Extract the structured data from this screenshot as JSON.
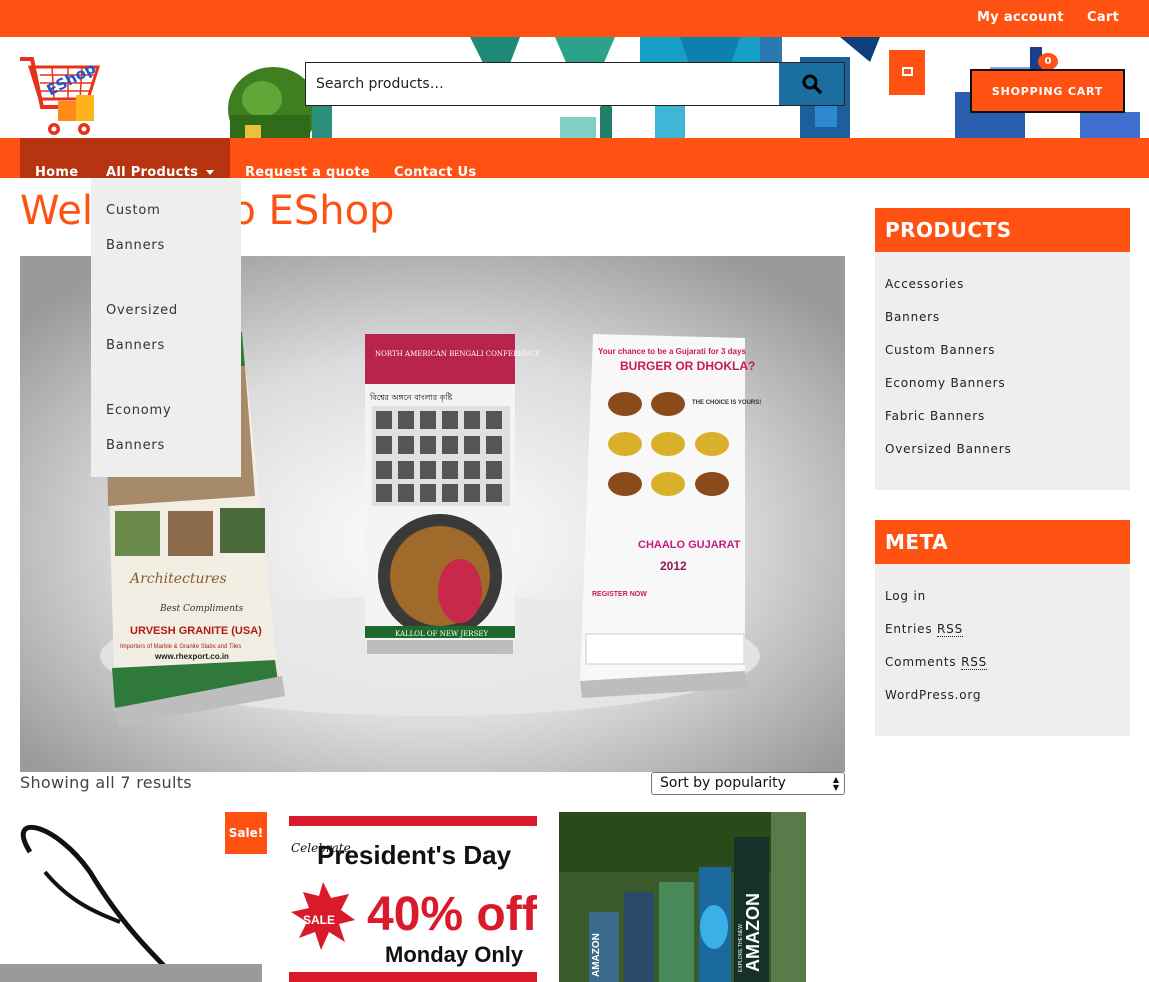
{
  "topbar": {
    "my_account": "My account",
    "cart": "Cart"
  },
  "header": {
    "logo_text": "EShop",
    "search_placeholder": "Search products…",
    "cart_count": "0",
    "shopping_cart_label": "SHOPPING CART"
  },
  "nav": {
    "items": [
      "Home",
      "All Products",
      "Request a quote",
      "Contact Us"
    ],
    "dropdown": [
      "Custom",
      "Banners",
      "Oversized",
      "Banners",
      "Economy",
      "Banners"
    ]
  },
  "page": {
    "title": "Welcome to EShop",
    "results": "Showing all 7 results",
    "sort_selected": "Sort by popularity"
  },
  "hero_banners": {
    "left": {
      "headline": "URVESH GRANITE (USA)",
      "subline": "Importers of Marble & Granite Slabs and Tiles",
      "url": "www.rhexport.co.in",
      "script": "Architectures",
      "compliments": "Best Compliments"
    },
    "center": {
      "headline": "NORTH AMERICAN BENGALI CONFERENCE",
      "bengali": "বিশ্বের অঙ্গনে বাংলার কৃষ্টি",
      "footer": "KALLOL OF NEW JERSEY"
    },
    "right": {
      "top": "Your chance to be a Gujarati for 3 days",
      "headline": "BURGER OR DHOKLA?",
      "choice": "THE CHOICE IS YOURS!",
      "event": "CHAALO GUJARAT",
      "year": "2012",
      "register": "REGISTER NOW"
    }
  },
  "products": {
    "sale_badge": "Sale!",
    "p2": {
      "line1": "President's Day",
      "pct": "40% off",
      "line3": "Monday Only",
      "badge": "SALE",
      "script": "Celebrate"
    },
    "p3": {
      "flag1": "AMAZON",
      "flag2": "AMAZON",
      "flag_sub": "EXPLORE THE NEW"
    }
  },
  "sidebar": {
    "products_title": "PRODUCTS",
    "products": [
      "Accessories",
      "Banners",
      "Custom Banners",
      "Economy Banners",
      "Fabric Banners",
      "Oversized Banners"
    ],
    "meta_title": "META",
    "meta": {
      "login": "Log in",
      "entries": "Entries",
      "comments": "Comments",
      "rss": "RSS",
      "wordpress": "WordPress.org"
    }
  },
  "colors": {
    "accent": "#ff5212",
    "nav_active": "#b83410",
    "search_button": "#1a6ea0"
  }
}
